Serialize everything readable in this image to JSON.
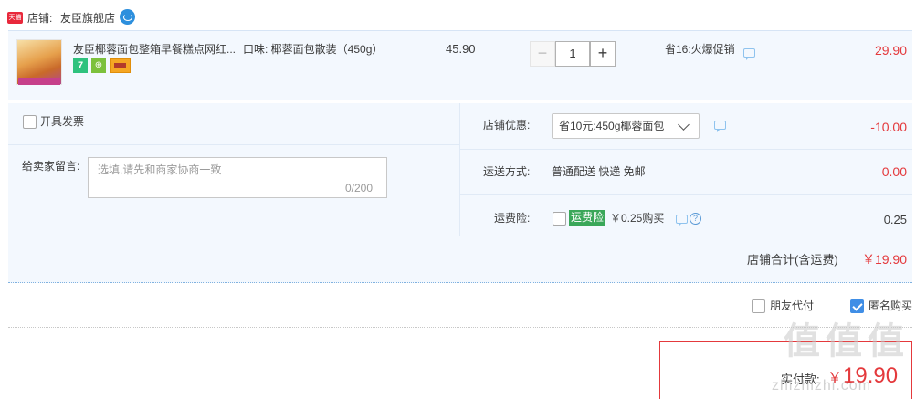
{
  "shop": {
    "badge": "天猫",
    "label": "店铺:",
    "name": "友臣旗舰店"
  },
  "item": {
    "thumb_caption": "第二件0元",
    "title": "友臣椰蓉面包整箱早餐糕点网红...",
    "sku": "口味: 椰蓉面包散装（450g）",
    "unit_price": "45.90",
    "badges": [
      "7",
      "bag-icon",
      "card-icon"
    ],
    "quantity": {
      "minus": "−",
      "value": "1",
      "plus": "+"
    },
    "promo": "省16:火爆促销",
    "subtotal": "29.90"
  },
  "order": {
    "invoice_label": "开具发票",
    "message_label": "给卖家留言:",
    "message_placeholder": "选填,请先和商家协商一致",
    "message_count": "0/200",
    "discount_label": "店铺优惠:",
    "discount_selected": "省10元:450g椰蓉面包",
    "discount_amount": "-10.00",
    "shipping_label": "运送方式:",
    "shipping_value": "普通配送 快递 免邮",
    "shipping_cost": "0.00",
    "insurance_label": "运费险:",
    "insurance_tag": "运费险",
    "insurance_price": "￥0.25购买",
    "insurance_amount": "0.25",
    "subtotal_label": "店铺合计(含运费)",
    "subtotal_value": "￥19.90"
  },
  "options": {
    "friend_pay": "朋友代付",
    "anonymous": "匿名购买",
    "anonymous_checked": true
  },
  "payment": {
    "label": "实付款:",
    "yen": "￥",
    "value": "19.90"
  },
  "watermark": {
    "logo": "值值值",
    "url": "zhizhizhi.com"
  },
  "colors": {
    "accent_red": "#e4393c",
    "row_bg": "#f3f8fe",
    "checkbox_blue": "#3f8ee6",
    "insurance_green": "#3aa759"
  }
}
